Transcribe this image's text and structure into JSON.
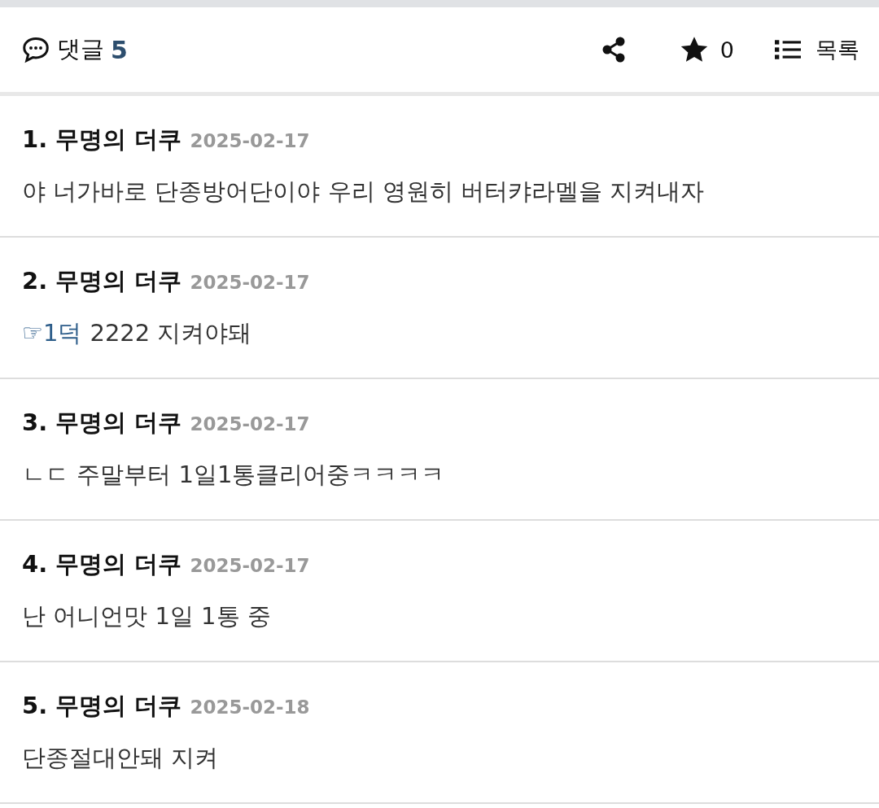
{
  "header": {
    "label": "댓글",
    "count": "5",
    "star_count": "0",
    "list_label": "목록"
  },
  "comments": [
    {
      "number": "1.",
      "author": "무명의 더쿠",
      "date": "2025-02-17",
      "text": "야 너가바로 단종방어단이야 우리 영원히 버터캬라멜을 지켜내자"
    },
    {
      "number": "2.",
      "author": "무명의 더쿠",
      "date": "2025-02-17",
      "reply_link": "☞1덕",
      "text": "2222 지켜야돼"
    },
    {
      "number": "3.",
      "author": "무명의 더쿠",
      "date": "2025-02-17",
      "text": "ㄴㄷ 주말부터 1일1통클리어중ㅋㅋㅋㅋ"
    },
    {
      "number": "4.",
      "author": "무명의 더쿠",
      "date": "2025-02-17",
      "text": "난 어니언맛 1일 1통 중"
    },
    {
      "number": "5.",
      "author": "무명의 더쿠",
      "date": "2025-02-18",
      "text": "단종절대안돼 지켜"
    }
  ]
}
